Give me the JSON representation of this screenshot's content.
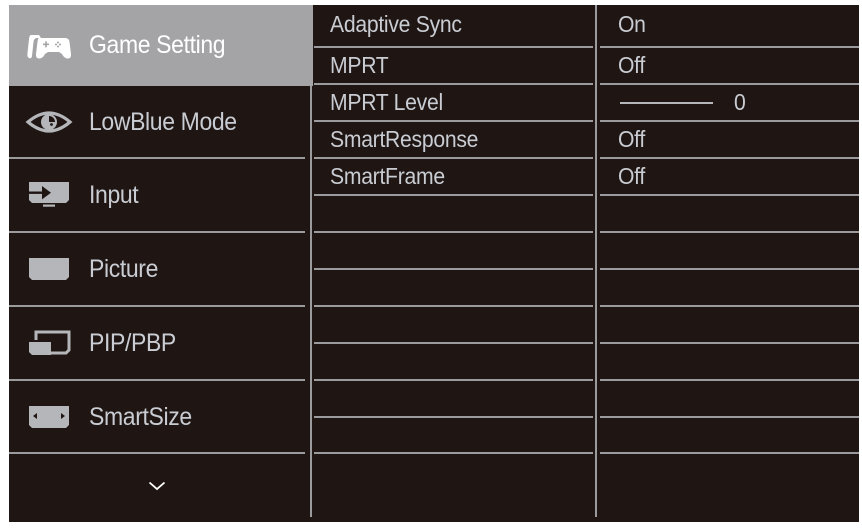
{
  "sidebar": {
    "items": [
      {
        "label": "Game Setting",
        "icon": "gamepad-icon",
        "active": true
      },
      {
        "label": "LowBlue Mode",
        "icon": "eye-icon",
        "active": false
      },
      {
        "label": "Input",
        "icon": "input-icon",
        "active": false
      },
      {
        "label": "Picture",
        "icon": "picture-icon",
        "active": false
      },
      {
        "label": "PIP/PBP",
        "icon": "pip-icon",
        "active": false
      },
      {
        "label": "SmartSize",
        "icon": "smartsize-icon",
        "active": false
      }
    ],
    "more_icon": "chevron-down-icon"
  },
  "settings": {
    "rows": [
      {
        "label": "Adaptive Sync",
        "value": "On"
      },
      {
        "label": "MPRT",
        "value": "Off"
      },
      {
        "label": "MPRT Level",
        "value": "0",
        "type": "slider",
        "slider_fraction": 0
      },
      {
        "label": "SmartResponse",
        "value": "Off"
      },
      {
        "label": "SmartFrame",
        "value": "Off"
      }
    ],
    "empty_rows": 7
  },
  "colors": {
    "background": "#1f1614",
    "active_highlight": "#a4a4a6",
    "divider": "#9b9b9d",
    "text": "#c9ccd2",
    "active_text": "#ffffff"
  }
}
